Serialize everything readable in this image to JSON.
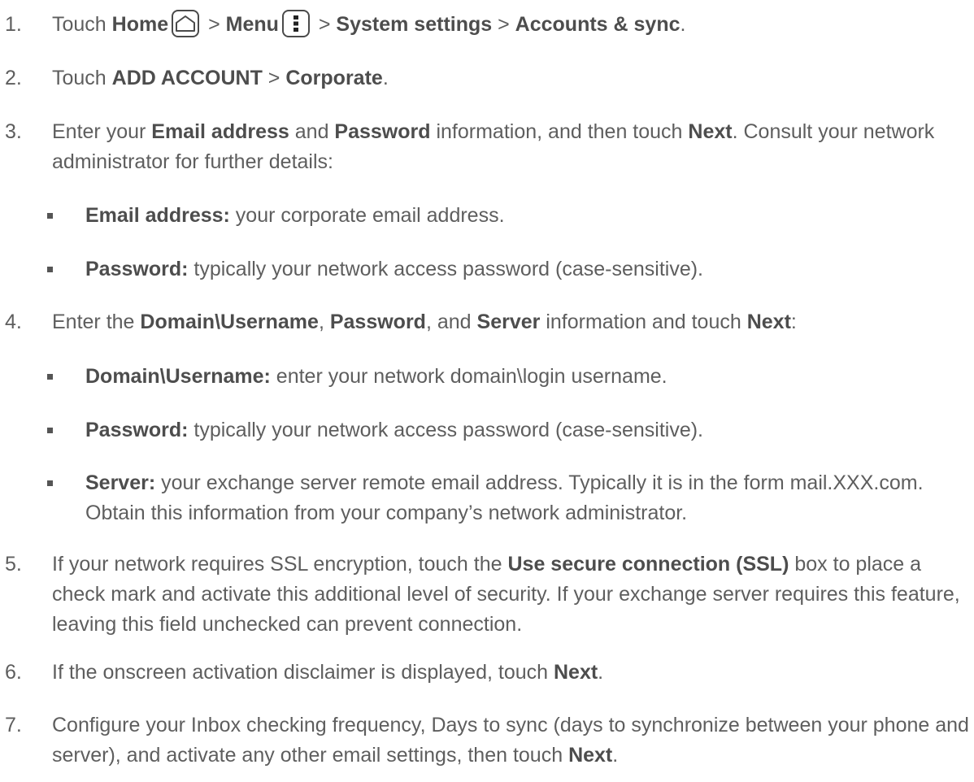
{
  "steps": [
    {
      "number": "1.",
      "parts": {
        "touch": "Touch ",
        "home": "Home",
        "sep1": " > ",
        "menu": "Menu",
        "sep2": " > ",
        "system_settings": "System settings",
        "sep3": " > ",
        "accounts_sync": "Accounts & sync",
        "end": "."
      }
    },
    {
      "number": "2.",
      "parts": {
        "touch": "Touch ",
        "add_account": "ADD ACCOUNT",
        "sep": " > ",
        "corporate": "Corporate",
        "end": "."
      }
    },
    {
      "number": "3.",
      "parts": {
        "enter": "Enter your ",
        "email_address": "Email address",
        "and": " and ",
        "password": "Password",
        "rest1": " information, and then touch ",
        "next": "Next",
        "rest2": ". Consult your network administrator for further details:"
      },
      "bullets": [
        {
          "term": "Email address:",
          "text": " your corporate email address."
        },
        {
          "term": "Password:",
          "text": " typically your network access password (case-sensitive)."
        }
      ]
    },
    {
      "number": "4.",
      "parts": {
        "enter": "Enter the ",
        "domain_username": "Domain\\Username",
        "comma1": ", ",
        "password": "Password",
        "comma2": ", and ",
        "server": "Server",
        "rest": " information and touch ",
        "next": "Next",
        "end": ":"
      },
      "bullets": [
        {
          "term": "Domain\\Username:",
          "text": " enter your network domain\\login username."
        },
        {
          "term": "Password:",
          "text": " typically your network access password (case-sensitive)."
        },
        {
          "term": "Server:",
          "text": " your exchange server remote email address. Typically it is in the form mail.XXX.com. Obtain this information from your company’s network administrator."
        }
      ]
    },
    {
      "number": "5.",
      "parts": {
        "intro": "If your network requires SSL encryption, touch the ",
        "ssl": "Use secure connection (SSL)",
        "rest": " box to place a check mark and activate this additional level of security. If your exchange server requires this feature, leaving this field unchecked can prevent connection."
      }
    },
    {
      "number": "6.",
      "parts": {
        "intro": "If the onscreen activation disclaimer is displayed, touch ",
        "next": "Next",
        "end": "."
      }
    },
    {
      "number": "7.",
      "parts": {
        "intro": "Configure your Inbox checking frequency, Days to sync (days to synchronize between your phone and server), and activate any other email settings, then touch ",
        "next": "Next",
        "end": "."
      }
    }
  ],
  "icons": {
    "home": "home-icon",
    "menu": "menu-icon"
  }
}
